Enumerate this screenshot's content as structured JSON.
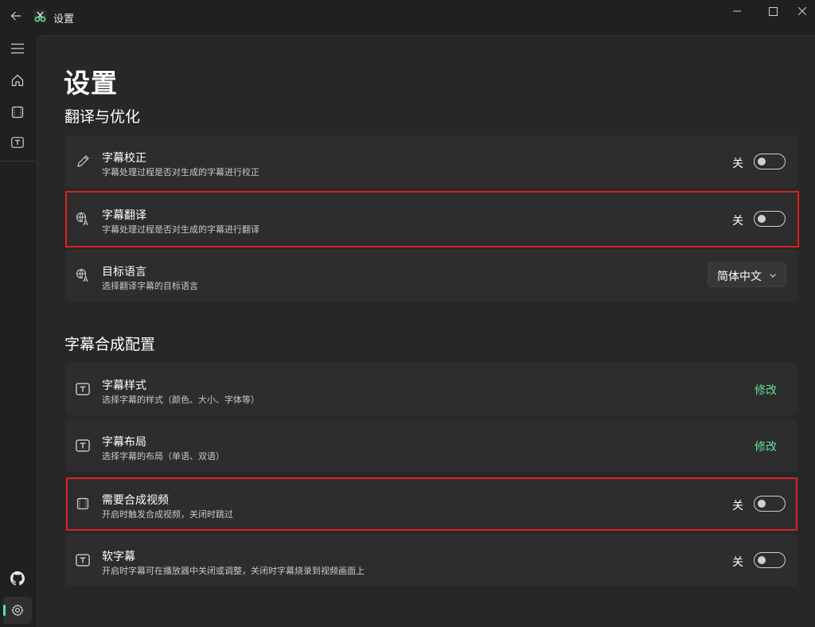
{
  "window": {
    "title": "设置",
    "accent": "#5ce19a",
    "highlight_color": "#e02020"
  },
  "nav": {
    "items": [
      {
        "icon": "menu-icon"
      },
      {
        "icon": "home-icon"
      },
      {
        "icon": "video-icon"
      },
      {
        "icon": "subtitle-icon"
      },
      {
        "icon": "github-icon"
      },
      {
        "icon": "gear-icon",
        "active": true
      }
    ]
  },
  "page": {
    "title": "设置"
  },
  "groups": [
    {
      "title": "翻译与优化",
      "cards": [
        {
          "icon": "pencil-icon",
          "title": "字幕校正",
          "desc": "字幕处理过程是否对生成的字幕进行校正",
          "control": "toggle",
          "state_label": "关"
        },
        {
          "icon": "translate-icon",
          "title": "字幕翻译",
          "desc": "字幕处理过程是否对生成的字幕进行翻译",
          "control": "toggle",
          "state_label": "关"
        },
        {
          "icon": "translate-icon",
          "title": "目标语言",
          "desc": "选择翻译字幕的目标语言",
          "control": "dropdown",
          "value": "简体中文"
        }
      ]
    },
    {
      "title": "字幕合成配置",
      "cards": [
        {
          "icon": "subtitle-icon",
          "title": "字幕样式",
          "desc": "选择字幕的样式（颜色、大小、字体等）",
          "control": "link",
          "action_label": "修改"
        },
        {
          "icon": "subtitle-icon",
          "title": "字幕布局",
          "desc": "选择字幕的布局（单语、双语）",
          "control": "link",
          "action_label": "修改"
        },
        {
          "icon": "video-icon",
          "title": "需要合成视频",
          "desc": "开启时触发合成视频，关闭时跳过",
          "control": "toggle",
          "state_label": "关"
        },
        {
          "icon": "subtitle-icon",
          "title": "软字幕",
          "desc": "开启时字幕可在播放器中关闭或调整，关闭时字幕烧录到视频画面上",
          "control": "toggle",
          "state_label": "关"
        }
      ]
    }
  ]
}
